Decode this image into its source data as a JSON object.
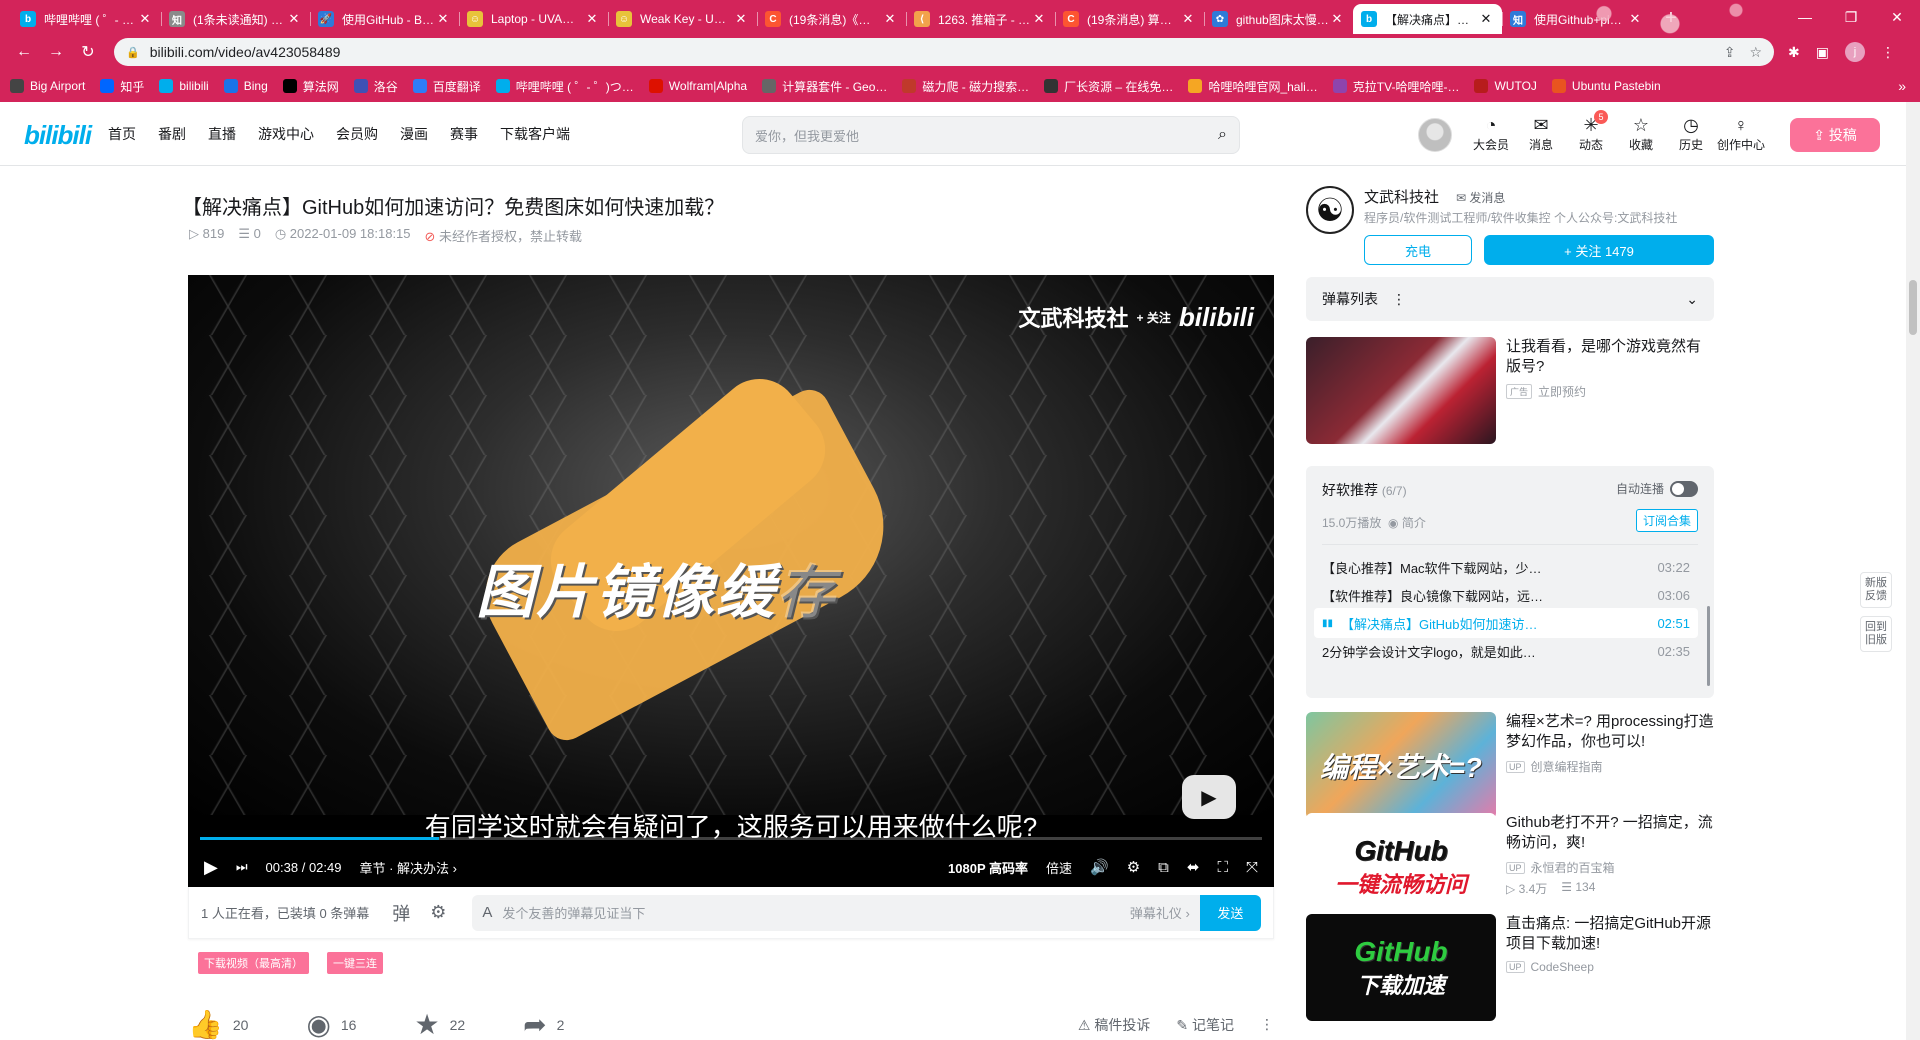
{
  "browser": {
    "tabs": [
      {
        "label": "哔哩哔哩 ( ゜- ゜)つ…",
        "color": "#00aeec",
        "glyph": "b"
      },
      {
        "label": "(1条未读通知) …",
        "color": "#8a8a8a",
        "glyph": "知"
      },
      {
        "label": "使用GitHub - B…",
        "color": "#2f7ad8",
        "glyph": "🚀"
      },
      {
        "label": "Laptop - UVA…",
        "color": "#e8c33a",
        "glyph": "☺"
      },
      {
        "label": "Weak Key - UV…",
        "color": "#e8c33a",
        "glyph": "☺"
      },
      {
        "label": "(19条消息)《…",
        "color": "#fc5531",
        "glyph": "C"
      },
      {
        "label": "1263. 推箱子 - …",
        "color": "#f2a24b",
        "glyph": "⟨"
      },
      {
        "label": "(19条消息) 算法…",
        "color": "#fc5531",
        "glyph": "C"
      },
      {
        "label": "github图床太慢…",
        "color": "#2f7ad8",
        "glyph": "✿"
      },
      {
        "label": "【解决痛点】Gi…",
        "color": "#00aeec",
        "glyph": "b",
        "active": true
      },
      {
        "label": "使用Github+pi…",
        "color": "#2f7ad8",
        "glyph": "知"
      }
    ],
    "url": "bilibili.com/video/av423058489",
    "profile_initial": "j",
    "bookmarks": [
      {
        "label": "Big Airport",
        "color": "#444"
      },
      {
        "label": "知乎",
        "color": "#0066ff"
      },
      {
        "label": "bilibili",
        "color": "#00aeec"
      },
      {
        "label": "Bing",
        "color": "#1a73e8"
      },
      {
        "label": "算法网",
        "color": "#000"
      },
      {
        "label": "洛谷",
        "color": "#3f51b5"
      },
      {
        "label": "百度翻译",
        "color": "#2e7cf6"
      },
      {
        "label": "哔哩哔哩 ( ゜- ゜)つ…",
        "color": "#00aeec"
      },
      {
        "label": "Wolfram|Alpha",
        "color": "#dd1100"
      },
      {
        "label": "计算器套件 - Geo…",
        "color": "#666"
      },
      {
        "label": "磁力爬 - 磁力搜索…",
        "color": "#c0392b"
      },
      {
        "label": "厂长资源 – 在线免…",
        "color": "#333"
      },
      {
        "label": "哈哩哈哩官网_hali…",
        "color": "#f5a623"
      },
      {
        "label": "克拉TV-哈哩哈哩-…",
        "color": "#8e44ad"
      },
      {
        "label": "WUTOJ",
        "color": "#b71c1c"
      },
      {
        "label": "Ubuntu Pastebin",
        "color": "#e95420"
      }
    ]
  },
  "site": {
    "logo": "bilibili",
    "nav": [
      "首页",
      "番剧",
      "直播",
      "游戏中心",
      "会员购",
      "漫画",
      "赛事",
      "下载客户端"
    ],
    "search_placeholder": "爱你，但我更爱他",
    "header_icons": [
      {
        "label": "大会员",
        "glyph": "◔",
        "icon": "vip-icon"
      },
      {
        "label": "消息",
        "glyph": "✉",
        "icon": "message-icon"
      },
      {
        "label": "动态",
        "glyph": "✳",
        "icon": "dynamic-icon",
        "badge": "5"
      },
      {
        "label": "收藏",
        "glyph": "☆",
        "icon": "favorite-icon"
      },
      {
        "label": "历史",
        "glyph": "◷",
        "icon": "history-icon"
      },
      {
        "label": "创作中心",
        "glyph": "♀",
        "icon": "creator-icon"
      }
    ],
    "upload_label": "投稿"
  },
  "video": {
    "title": "【解决痛点】GitHub如何加速访问？免费图床如何快速加载？",
    "views": "819",
    "danmaku_count": "0",
    "date": "2022-01-09 18:18:15",
    "copyright": "未经作者授权，禁止转载",
    "watermark_text": "文武科技社",
    "watermark_logo": "bilibili",
    "follow_overlay": "+ 关注",
    "overlay_text_main": "图片镜像缓",
    "overlay_text_faint": "存",
    "subtitle": "有同学这时就会有疑问了，这服务可以用来做什么呢?",
    "current_time": "00:38",
    "duration": "02:49",
    "progress": 0.225,
    "chapter": "章节 · 解决办法",
    "quality": "1080P 高码率",
    "speed": "倍速",
    "viewers_text": "1 人正在看，已装填 0 条弹幕",
    "danmaku_placeholder": "发个友善的弹幕见证当下",
    "danmaku_etiquette": "弹幕礼仪",
    "send_label": "发送",
    "tags": [
      "下载视频（最高清）",
      "一键三连"
    ],
    "likes": "20",
    "coins": "16",
    "favorites": "22",
    "shares": "2",
    "report_label": "稿件投诉",
    "notes_label": "记笔记"
  },
  "uploader": {
    "name": "文武科技社",
    "message_label": "发消息",
    "description": "程序员/软件测试工程师/软件收集控 个人公众号:文武科技社",
    "charge_label": "充电",
    "follow_label": "+ 关注 1479"
  },
  "sidebar": {
    "danmaku_list_label": "弹幕列表",
    "ad": {
      "title": "让我看看，是哪个游戏竟然有版号?",
      "ad_tag": "广告",
      "cta": "立即预约"
    },
    "playlist": {
      "title": "好软推荐",
      "count": "(6/7)",
      "autoplay_label": "自动连播",
      "stats": "15.0万播放",
      "intro_label": "简介",
      "subscribe_label": "订阅合集",
      "items": [
        {
          "title": "【良心推荐】Mac软件下载网站，少…",
          "duration": "03:22"
        },
        {
          "title": "【软件推荐】良心镜像下载网站，远…",
          "duration": "03:06"
        },
        {
          "title": "【解决痛点】GitHub如何加速访…",
          "duration": "02:51",
          "active": true
        },
        {
          "title": "2分钟学会设计文字logo，就是如此…",
          "duration": "02:35"
        }
      ]
    },
    "recommendations": [
      {
        "title": "编程×艺术=? 用processing打造梦幻作品，你也可以!",
        "author": "创意编程指南",
        "thumb_text": "编程×艺术=?",
        "plays": "",
        "danmaku": ""
      },
      {
        "title": "Github老打不开? 一招搞定，流畅访问，爽!",
        "author": "永恒君的百宝箱",
        "thumb_text": "GitHub",
        "thumb_sub": "一键流畅访问",
        "plays": "3.4万",
        "danmaku": "134"
      },
      {
        "title": "直击痛点: 一招搞定GitHub开源项目下载加速!",
        "author": "CodeSheep",
        "thumb_text": "GitHub",
        "thumb_sub": "下载加速",
        "plays": "",
        "danmaku": ""
      }
    ],
    "side_buttons": [
      "新版反馈",
      "回到旧版"
    ]
  }
}
